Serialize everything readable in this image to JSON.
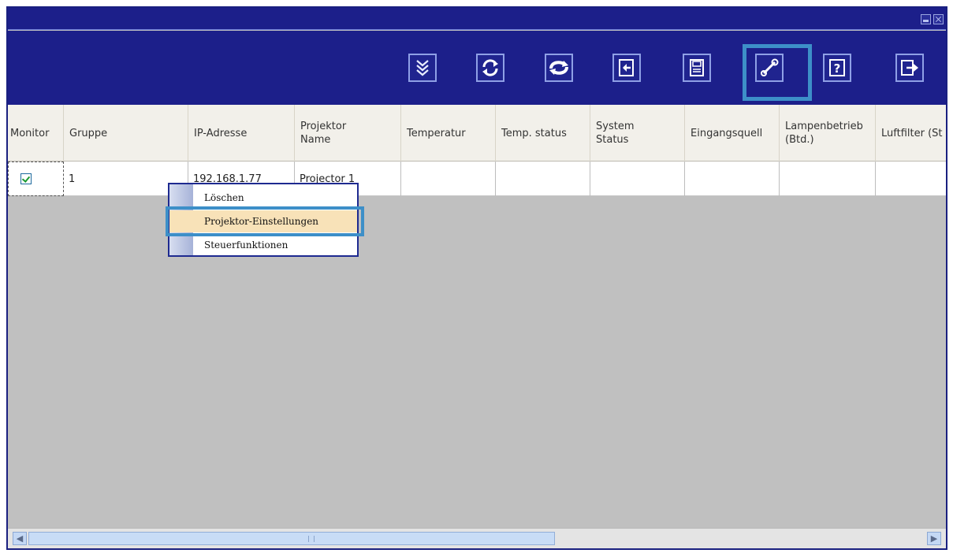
{
  "window": {
    "controls": [
      "minimize-icon",
      "close-icon"
    ]
  },
  "toolbar": {
    "buttons": [
      {
        "name": "expand-down-icon"
      },
      {
        "name": "refresh-icon"
      },
      {
        "name": "sync-icon"
      },
      {
        "name": "import-icon"
      },
      {
        "name": "save-icon"
      },
      {
        "name": "tools-icon",
        "highlighted": true
      },
      {
        "name": "help-icon"
      },
      {
        "name": "exit-icon"
      }
    ],
    "accent": "#3d8fc8"
  },
  "table": {
    "columns": [
      "Monitor",
      "Gruppe",
      "IP-Adresse",
      "Projektor Name",
      "Temperatur",
      "Temp. status",
      "System Status",
      "Eingangsquell",
      "Lampenbetrieb (Btd.)",
      "Luftfilter (St"
    ],
    "rows": [
      {
        "monitor": true,
        "gruppe": "1",
        "ip": "192.168.1.77",
        "name": "Projector 1",
        "temperatur": "",
        "temp_status": "",
        "system_status": "",
        "eingangsquelle": "",
        "lampenbetrieb": "",
        "luftfilter": ""
      }
    ]
  },
  "context_menu": {
    "items": [
      "Löschen",
      "Projektor-Einstellungen",
      "Steuerfunktionen"
    ],
    "selected": "Projektor-Einstellungen"
  },
  "colors": {
    "titlebar": "#1c1f8a",
    "highlight": "#3d8fc8",
    "menu_selected": "#f8e2b8"
  }
}
